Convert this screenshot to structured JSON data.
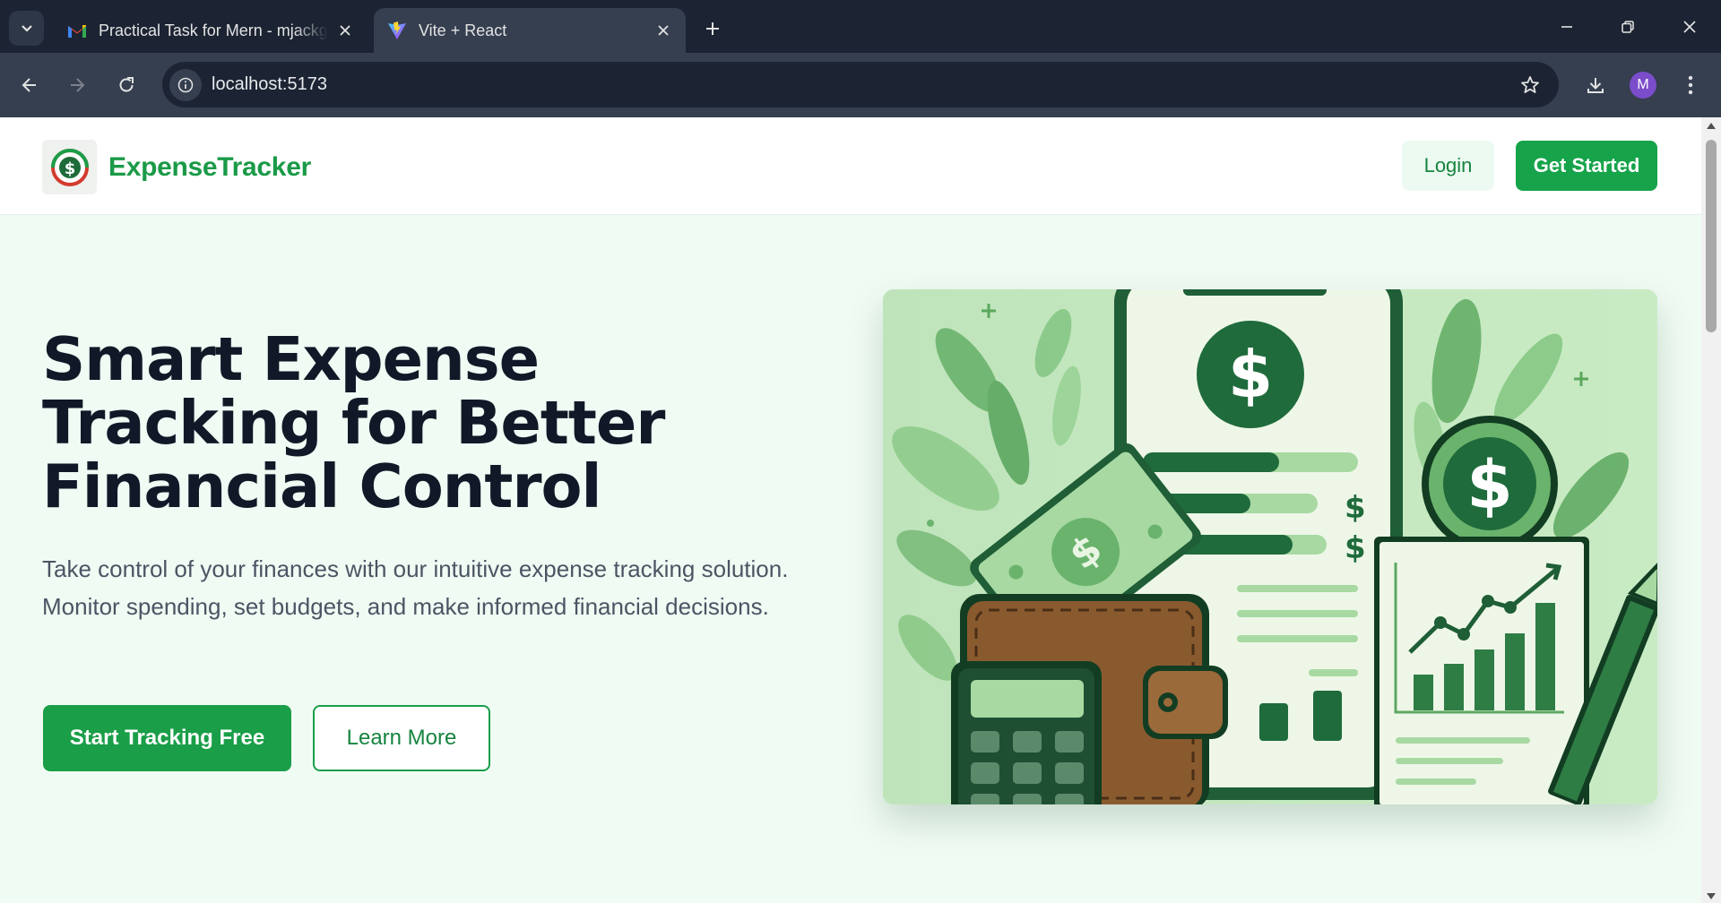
{
  "browser": {
    "tabs": [
      {
        "title": "Practical Task for Mern - mjackg",
        "favicon": "gmail-icon",
        "active": false
      },
      {
        "title": "Vite + React",
        "favicon": "vite-icon",
        "active": true
      }
    ],
    "url": "localhost:5173",
    "profile_initial": "M"
  },
  "header": {
    "brand": "ExpenseTracker",
    "login_label": "Login",
    "get_started_label": "Get Started"
  },
  "hero": {
    "title": "Smart Expense Tracking for Better Financial Control",
    "subtitle": "Take control of your finances with our intuitive expense tracking solution. Monitor spending, set budgets, and make informed financial decisions.",
    "primary_cta": "Start Tracking Free",
    "secondary_cta": "Learn More"
  },
  "colors": {
    "brand_green": "#1a9e48",
    "page_background": "#f0fbf4",
    "heading": "#111827"
  }
}
